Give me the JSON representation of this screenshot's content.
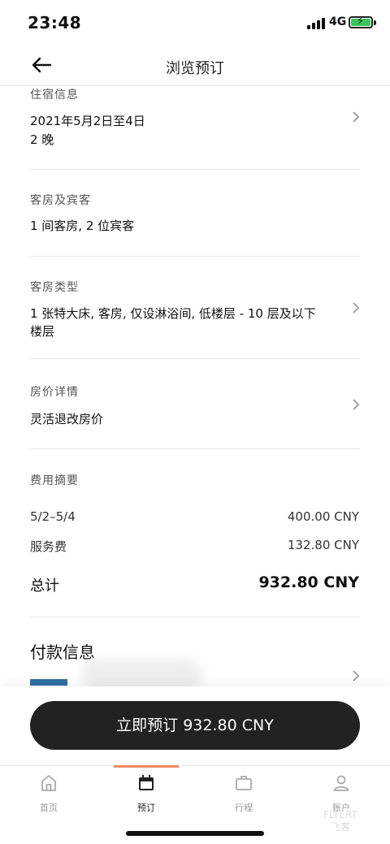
{
  "status_bar": {
    "time": "23:48",
    "network": "4G"
  },
  "header": {
    "title": "浏览预订"
  },
  "stay": {
    "label": "住宿信息",
    "dates": "2021年5月2日至4日",
    "nights": "2 晚"
  },
  "rooms_guests": {
    "label": "客房及宾客",
    "value": "1 间客房, 2 位宾客"
  },
  "room_type": {
    "label": "客房类型",
    "line1": "1 张特大床, 客房, 仅设淋浴间, 低楼层 - 10 层及以下",
    "line2": "楼层"
  },
  "rate": {
    "label": "房价详情",
    "value": "灵活退改房价"
  },
  "summary": {
    "label": "费用摘要",
    "rows": [
      {
        "name": "5/2–5/4",
        "amount": "400.00 CNY"
      },
      {
        "name": "服务费",
        "amount": "132.80 CNY"
      }
    ],
    "total_label": "总计",
    "total_amount": "932.80 CNY"
  },
  "payment": {
    "label": "付款信息"
  },
  "book_button": {
    "label": "立即预订 932.80 CNY"
  },
  "tabs": [
    {
      "label": "首页",
      "icon": "home-icon"
    },
    {
      "label": "预订",
      "icon": "calendar-icon",
      "active": true
    },
    {
      "label": "行程",
      "icon": "briefcase-icon"
    },
    {
      "label": "账户",
      "icon": "user-icon"
    }
  ],
  "watermark": {
    "line1": "FLYERT",
    "line2": "飞客"
  },
  "colors": {
    "accent": "#f08a5d",
    "button": "#222222",
    "card": "#2f6fa0",
    "battery": "#3ac45a"
  }
}
